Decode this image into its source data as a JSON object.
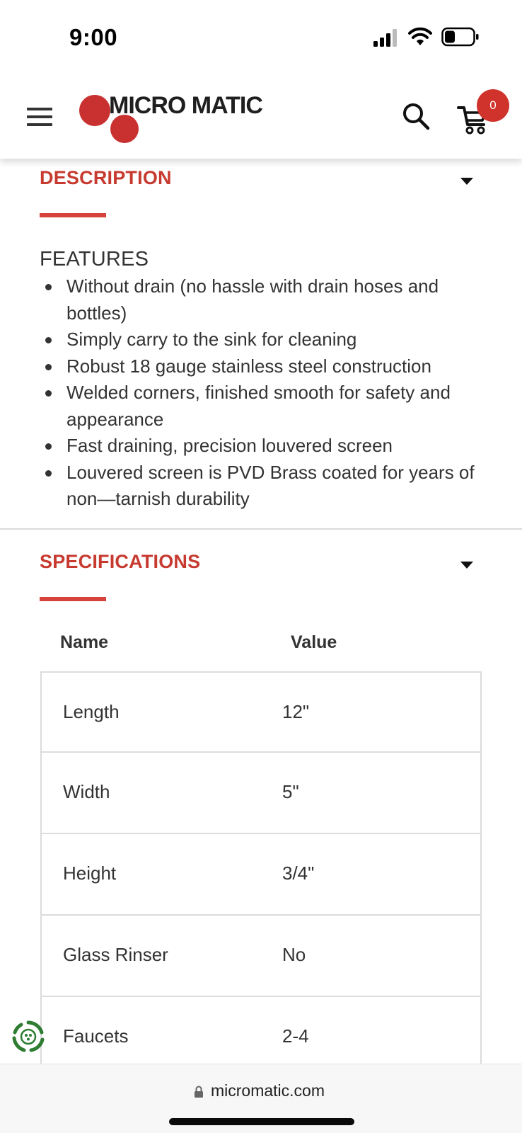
{
  "status_bar": {
    "time": "9:00"
  },
  "header": {
    "logo_text": "MICRO MATIC",
    "brand_color": "#c8312f",
    "cart_count": "0"
  },
  "description": {
    "heading": "DESCRIPTION",
    "features_title": "FEATURES",
    "features": [
      "Without drain (no hassle with drain hoses and bottles)",
      "Simply carry to the sink for cleaning",
      "Robust 18 gauge stainless steel construction",
      "Welded corners, finished smooth for safety and appearance",
      "Fast draining, precision louvered screen",
      "Louvered screen is PVD Brass coated for years of non—tarnish durability"
    ]
  },
  "specifications": {
    "heading": "SPECIFICATIONS",
    "columns": [
      "Name",
      "Value"
    ],
    "rows": [
      {
        "name": "Length",
        "value": "12\""
      },
      {
        "name": "Width",
        "value": "5\""
      },
      {
        "name": "Height",
        "value": "3/4\""
      },
      {
        "name": "Glass Rinser",
        "value": "No"
      },
      {
        "name": "Faucets",
        "value": "2-4"
      }
    ]
  },
  "address_bar": {
    "url": "micromatic.com"
  },
  "icons": [
    "menu-icon",
    "search-icon",
    "cart-icon",
    "caret-down-icon",
    "lock-icon",
    "recycle-icon",
    "signal-icon",
    "wifi-icon",
    "battery-icon"
  ]
}
